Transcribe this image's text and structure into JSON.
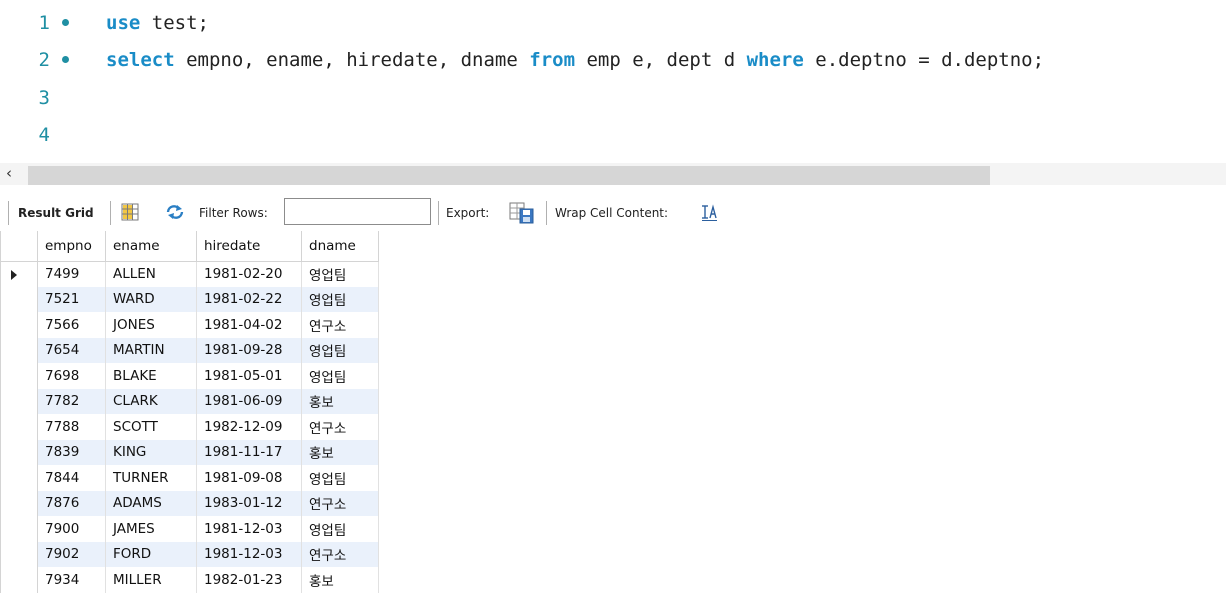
{
  "editor": {
    "lines": [
      {
        "number": "1",
        "has_marker": true,
        "tokens": [
          {
            "t": "use",
            "kw": true
          },
          {
            "t": " test;",
            "kw": false
          }
        ]
      },
      {
        "number": "2",
        "has_marker": true,
        "tokens": [
          {
            "t": "select",
            "kw": true
          },
          {
            "t": " empno, ename, hiredate, dname ",
            "kw": false
          },
          {
            "t": "from",
            "kw": true
          },
          {
            "t": " emp e, dept d ",
            "kw": false
          },
          {
            "t": "where",
            "kw": true
          },
          {
            "t": " e.deptno = d.deptno;",
            "kw": false
          }
        ]
      },
      {
        "number": "3",
        "has_marker": false,
        "tokens": []
      },
      {
        "number": "4",
        "has_marker": false,
        "tokens": []
      }
    ]
  },
  "toolbar": {
    "result_grid_label": "Result Grid",
    "filter_rows_label": "Filter Rows:",
    "filter_value": "",
    "export_label": "Export:",
    "wrap_label": "Wrap Cell Content:"
  },
  "grid": {
    "columns": [
      "empno",
      "ename",
      "hiredate",
      "dname"
    ],
    "rows": [
      [
        "7499",
        "ALLEN",
        "1981-02-20",
        "영업팀"
      ],
      [
        "7521",
        "WARD",
        "1981-02-22",
        "영업팀"
      ],
      [
        "7566",
        "JONES",
        "1981-04-02",
        "연구소"
      ],
      [
        "7654",
        "MARTIN",
        "1981-09-28",
        "영업팀"
      ],
      [
        "7698",
        "BLAKE",
        "1981-05-01",
        "영업팀"
      ],
      [
        "7782",
        "CLARK",
        "1981-06-09",
        "홍보"
      ],
      [
        "7788",
        "SCOTT",
        "1982-12-09",
        "연구소"
      ],
      [
        "7839",
        "KING",
        "1981-11-17",
        "홍보"
      ],
      [
        "7844",
        "TURNER",
        "1981-09-08",
        "영업팀"
      ],
      [
        "7876",
        "ADAMS",
        "1983-01-12",
        "연구소"
      ],
      [
        "7900",
        "JAMES",
        "1981-12-03",
        "영업팀"
      ],
      [
        "7902",
        "FORD",
        "1981-12-03",
        "연구소"
      ],
      [
        "7934",
        "MILLER",
        "1982-01-23",
        "홍보"
      ]
    ],
    "selected_row": 0
  },
  "icons": {
    "grid_icon": "grid-layout-icon",
    "refresh_icon": "refresh-icon",
    "export_icon": "export-icon",
    "wrap_icon": "wrap-cell-icon",
    "scroll_left": "scroll-left-arrow-icon"
  },
  "colors": {
    "keyword": "#1a8cc7",
    "line_number": "#1f8fa3",
    "alt_row": "#eaf1fb"
  }
}
